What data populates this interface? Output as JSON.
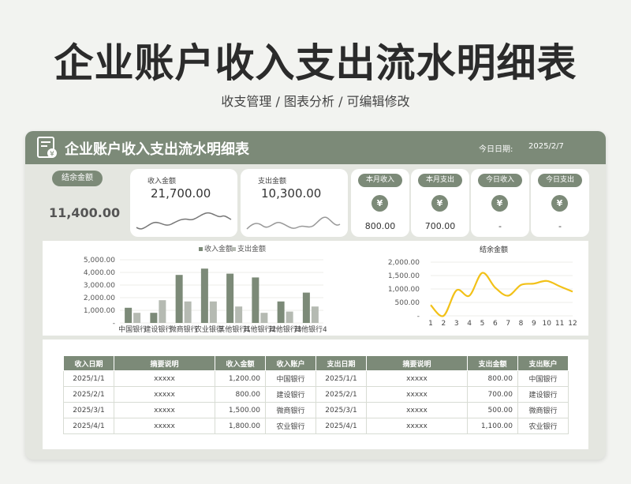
{
  "hero": {
    "title": "企业账户收入支出流水明细表",
    "subtitle": "收支管理 /  图表分析  /  可编辑修改"
  },
  "header": {
    "title": "企业账户收入支出流水明细表",
    "date_label": "今日日期:",
    "date": "2025/2/7",
    "icon": "ledger-icon"
  },
  "balance": {
    "label": "结余金额",
    "value": "11,400.00"
  },
  "income_card": {
    "label": "收入金额",
    "value": "21,700.00"
  },
  "expense_card": {
    "label": "支出金额",
    "value": "10,300.00"
  },
  "stats": [
    {
      "label": "本月收入",
      "value": "800.00",
      "icon": "yen-icon"
    },
    {
      "label": "本月支出",
      "value": "700.00",
      "icon": "yen-icon"
    },
    {
      "label": "今日收入",
      "value": "-",
      "icon": "yen-icon"
    },
    {
      "label": "今日支出",
      "value": "-",
      "icon": "yen-icon"
    }
  ],
  "colors": {
    "accent": "#7c8a78",
    "income_bar": "#7c8a78",
    "expense_bar": "#b5bab2",
    "line": "#f2c118"
  },
  "chart_data": [
    {
      "type": "bar",
      "legend": [
        "收入金额",
        "支出金额"
      ],
      "categories": [
        "中国银行",
        "建设银行",
        "微商银行",
        "农业银行",
        "其他银行1",
        "其他银行2",
        "其他银行3",
        "其他银行4"
      ],
      "series": [
        {
          "name": "收入金额",
          "values": [
            1200,
            800,
            3800,
            4300,
            3900,
            3600,
            1700,
            2400
          ]
        },
        {
          "name": "支出金额",
          "values": [
            800,
            1800,
            1700,
            1700,
            1300,
            800,
            900,
            1300
          ]
        }
      ],
      "ylim": [
        0,
        5000
      ],
      "yticks": [
        "-",
        "1,000.00",
        "2,000.00",
        "3,000.00",
        "4,000.00",
        "5,000.00"
      ],
      "legend_position": "top"
    },
    {
      "type": "line",
      "title": "结余金额",
      "x": [
        1,
        2,
        3,
        4,
        5,
        6,
        7,
        8,
        9,
        10,
        11,
        12
      ],
      "values": [
        400,
        0,
        950,
        750,
        1600,
        1050,
        750,
        1150,
        1200,
        1300,
        1100,
        900
      ],
      "ylim": [
        0,
        2000
      ],
      "yticks": [
        "-",
        "500.00",
        "1,000.00",
        "1,500.00",
        "2,000.00"
      ]
    }
  ],
  "table": {
    "headers": [
      "收入日期",
      "摘要说明",
      "收入金额",
      "收入账户",
      "支出日期",
      "摘要说明",
      "支出金额",
      "支出账户"
    ],
    "rows": [
      [
        "2025/1/1",
        "xxxxx",
        "1,200.00",
        "中国银行",
        "2025/1/1",
        "xxxxx",
        "800.00",
        "中国银行"
      ],
      [
        "2025/2/1",
        "xxxxx",
        "800.00",
        "建设银行",
        "2025/2/1",
        "xxxxx",
        "700.00",
        "建设银行"
      ],
      [
        "2025/3/1",
        "xxxxx",
        "1,500.00",
        "微商银行",
        "2025/3/1",
        "xxxxx",
        "500.00",
        "微商银行"
      ],
      [
        "2025/4/1",
        "xxxxx",
        "1,800.00",
        "农业银行",
        "2025/4/1",
        "xxxxx",
        "1,100.00",
        "农业银行"
      ]
    ]
  }
}
